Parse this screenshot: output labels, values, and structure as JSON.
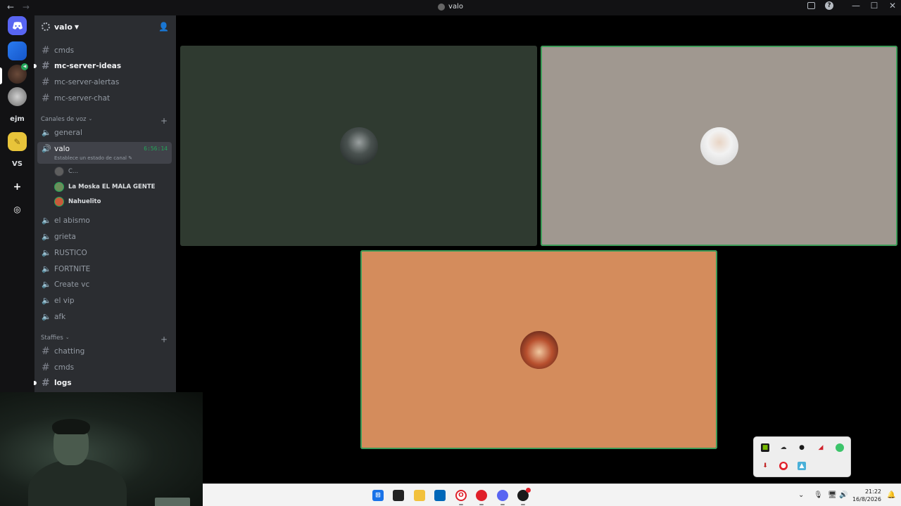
{
  "window": {
    "title": "valo",
    "nav_back": "←",
    "nav_forward": "→",
    "minimize": "—",
    "maximize": "☐",
    "close": "✕"
  },
  "rail": {
    "servers": [
      {
        "label": "",
        "color": "#5865f2",
        "name": "discord-home"
      },
      {
        "label": "",
        "color": "#1e6fe6",
        "name": "blue-server"
      },
      {
        "label": "",
        "color": "#5a3a2e",
        "name": "red-server"
      },
      {
        "label": "",
        "color": "#8a8a8a",
        "name": "wolf-server"
      },
      {
        "label": "ejm",
        "color": "#2b2d31",
        "name": "ejm-server"
      },
      {
        "label": "",
        "color": "#e8c43a",
        "name": "yellow-server"
      },
      {
        "label": "VS",
        "color": "#2b2d31",
        "name": "vs-server"
      },
      {
        "label": "+",
        "color": "#2b2d31",
        "name": "add-server"
      },
      {
        "label": "◎",
        "color": "#2b2d31",
        "name": "discover-servers"
      }
    ]
  },
  "sidebar": {
    "guild_name": "valo",
    "text_channels_top": [
      {
        "name": "cmds",
        "bold": false
      },
      {
        "name": "mc-server-ideas",
        "bold": true
      },
      {
        "name": "mc-server-alertas",
        "bold": false
      },
      {
        "name": "mc-server-chat",
        "bold": false
      }
    ],
    "voice_category": "Canales de voz",
    "voice_channels_before": [
      "general"
    ],
    "active_voice": {
      "name": "valo",
      "timer": "6:56:14",
      "status": "Establece un estado de canal"
    },
    "members": [
      {
        "name": "C...",
        "color": "#5e5e5e"
      },
      {
        "name": "La Moska EL MALA GENTE",
        "color": "#6b8e5a"
      },
      {
        "name": "Nahuelito",
        "color": "#c85a3a"
      }
    ],
    "voice_channels_after": [
      "el abismo",
      "grieta",
      "RUSTICO",
      "FORTNITE",
      "Create vc",
      "el vip",
      "afk"
    ],
    "staff_category": "Staffies",
    "staff_channels": [
      {
        "name": "chatting",
        "bold": false
      },
      {
        "name": "cmds",
        "bold": false
      },
      {
        "name": "logs",
        "bold": true
      }
    ]
  },
  "stage": {
    "tiles": [
      {
        "name": "tile-witcher",
        "bg": "#2f3a30",
        "avatar_color": "#3d4a44",
        "speaking": false
      },
      {
        "name": "tile-man",
        "bg": "#a09890",
        "avatar_color": "#d8d0c8",
        "speaking": true
      },
      {
        "name": "tile-anime",
        "bg": "#d48c5c",
        "avatar_color": "#7a2a1e",
        "speaking": true
      }
    ]
  },
  "taskbar": {
    "time": "21:22",
    "date": "16/8/2026"
  }
}
